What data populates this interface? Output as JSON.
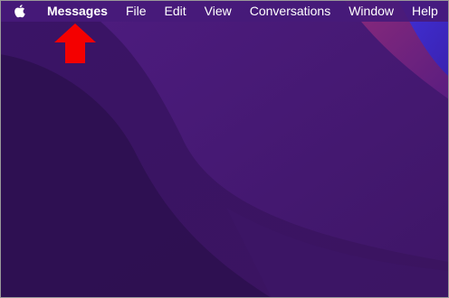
{
  "menubar": {
    "apple_icon": "apple-logo-icon",
    "app_name": "Messages",
    "items": [
      "File",
      "Edit",
      "View",
      "Conversations",
      "Window",
      "Help"
    ]
  },
  "annotation": {
    "icon": "red-up-arrow-icon",
    "color": "#f40000"
  },
  "colors": {
    "menubar": "#461a7a",
    "wallpaper_dark": "#2f1152",
    "wallpaper_mid": "#4a1a7a",
    "wallpaper_accent": "#8a2a78",
    "wallpaper_blue": "#3a2fd0"
  }
}
